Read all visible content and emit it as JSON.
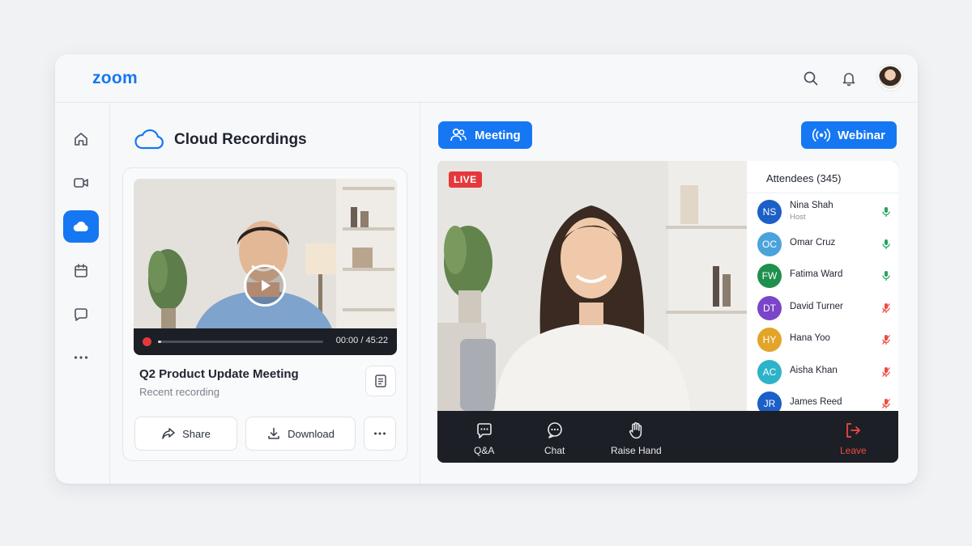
{
  "app": {
    "logo": "zoom"
  },
  "header": {
    "search_icon": "search-icon",
    "bell_icon": "bell-icon",
    "avatar": "user-avatar"
  },
  "sidebar": {
    "items": [
      {
        "icon": "home-icon",
        "active": false
      },
      {
        "icon": "video-icon",
        "active": false
      },
      {
        "icon": "cloud-icon",
        "active": true
      },
      {
        "icon": "calendar-icon",
        "active": false
      },
      {
        "icon": "chat-icon",
        "active": false
      },
      {
        "icon": "more-icon",
        "active": false
      }
    ]
  },
  "recordings": {
    "title": "Cloud Recordings",
    "card": {
      "time": "00:00 / 45:22",
      "progress": 0.0,
      "title": "Q2 Product Update Meeting",
      "subtitle": "Recent recording",
      "share_label": "Share",
      "download_label": "Download"
    }
  },
  "modes": {
    "meeting_label": "Meeting",
    "webinar_label": "Webinar"
  },
  "stage": {
    "live_label": "LIVE",
    "attendees_title": "Attendees (345)",
    "attendees": [
      {
        "initials": "NS",
        "name": "Nina Shah",
        "role": "Host",
        "color": "#1b5fc7",
        "mic": "on"
      },
      {
        "initials": "OC",
        "name": "Omar Cruz",
        "role": "",
        "color": "#4ba3dc",
        "mic": "on"
      },
      {
        "initials": "FW",
        "name": "Fatima Ward",
        "role": "",
        "color": "#1f8f4e",
        "mic": "on"
      },
      {
        "initials": "DT",
        "name": "David Turner",
        "role": "",
        "color": "#7a45c8",
        "mic": "off"
      },
      {
        "initials": "HY",
        "name": "Hana Yoo",
        "role": "",
        "color": "#e2a529",
        "mic": "off"
      },
      {
        "initials": "AC",
        "name": "Aisha Khan",
        "role": "",
        "color": "#2db3c9",
        "mic": "off"
      },
      {
        "initials": "JR",
        "name": "James Reed",
        "role": "",
        "color": "#1b5fc7",
        "mic": "off"
      }
    ],
    "toolbar": {
      "qa_label": "Q&A",
      "chat_label": "Chat",
      "raise_label": "Raise Hand",
      "leave_label": "Leave"
    }
  },
  "colors": {
    "accent": "#1677f2",
    "live": "#e5383b",
    "mic_on": "#22a55b",
    "mic_off": "#ef4b3f",
    "leave": "#ef4b3f"
  }
}
